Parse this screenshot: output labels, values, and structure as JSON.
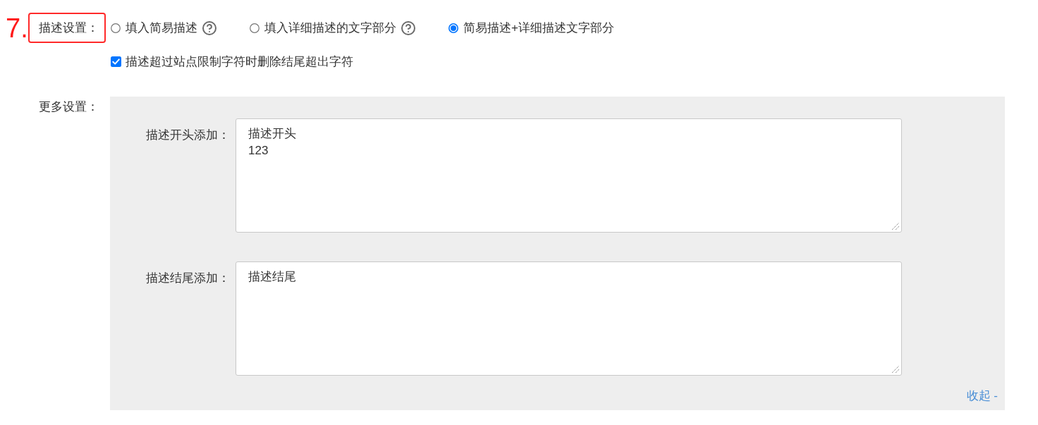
{
  "annotation": {
    "number": "7."
  },
  "description_setting": {
    "label": "描述设置：",
    "highlighted": true,
    "options": [
      {
        "label": "填入简易描述",
        "help": true,
        "selected": false
      },
      {
        "label": "填入详细描述的文字部分",
        "help": true,
        "selected": false
      },
      {
        "label": "简易描述+详细描述文字部分",
        "help": false,
        "selected": true
      }
    ],
    "truncate": {
      "label": "描述超过站点限制字符时删除结尾超出字符",
      "checked": true
    }
  },
  "more_settings": {
    "label": "更多设置：",
    "fields": [
      {
        "label": "描述开头添加：",
        "value": "描述开头\n123"
      },
      {
        "label": "描述结尾添加：",
        "value": "描述结尾"
      }
    ],
    "collapse_link": "收起 -"
  }
}
